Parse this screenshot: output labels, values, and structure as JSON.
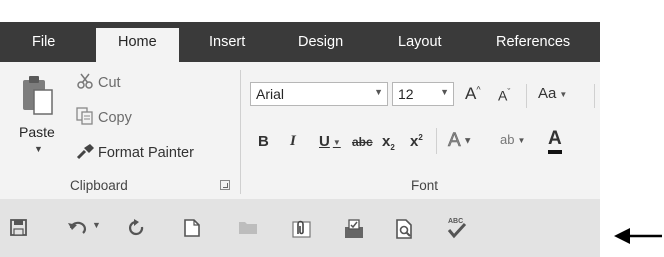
{
  "tabs": [
    "File",
    "Home",
    "Insert",
    "Design",
    "Layout",
    "References"
  ],
  "clipboard": {
    "paste": "Paste",
    "cut": "Cut",
    "copy": "Copy",
    "format_painter": "Format Painter",
    "group_label": "Clipboard"
  },
  "font": {
    "font_name": "Arial",
    "font_size": "12",
    "grow": "A",
    "shrink": "A",
    "change_case": "Aa",
    "bold": "B",
    "italic": "I",
    "underline": "U",
    "strikethrough": "abc",
    "subscript_base": "x",
    "subscript_mark": "2",
    "superscript_base": "x",
    "superscript_mark": "2",
    "text_effects": "A",
    "highlight": "ab",
    "font_color": "A",
    "group_label": "Font"
  },
  "quick_access": {
    "icons": [
      "save-icon",
      "undo-icon",
      "redo-icon",
      "new-document-icon",
      "open-folder-icon",
      "attach-file-icon",
      "send-icon",
      "print-preview-icon",
      "spelling-check-icon"
    ]
  },
  "colors": {
    "tab_bar": "#3a3a3a",
    "ribbon": "#f3f3f3",
    "toolbar": "#e3e3e3",
    "font_color_underline": "#c00000"
  }
}
